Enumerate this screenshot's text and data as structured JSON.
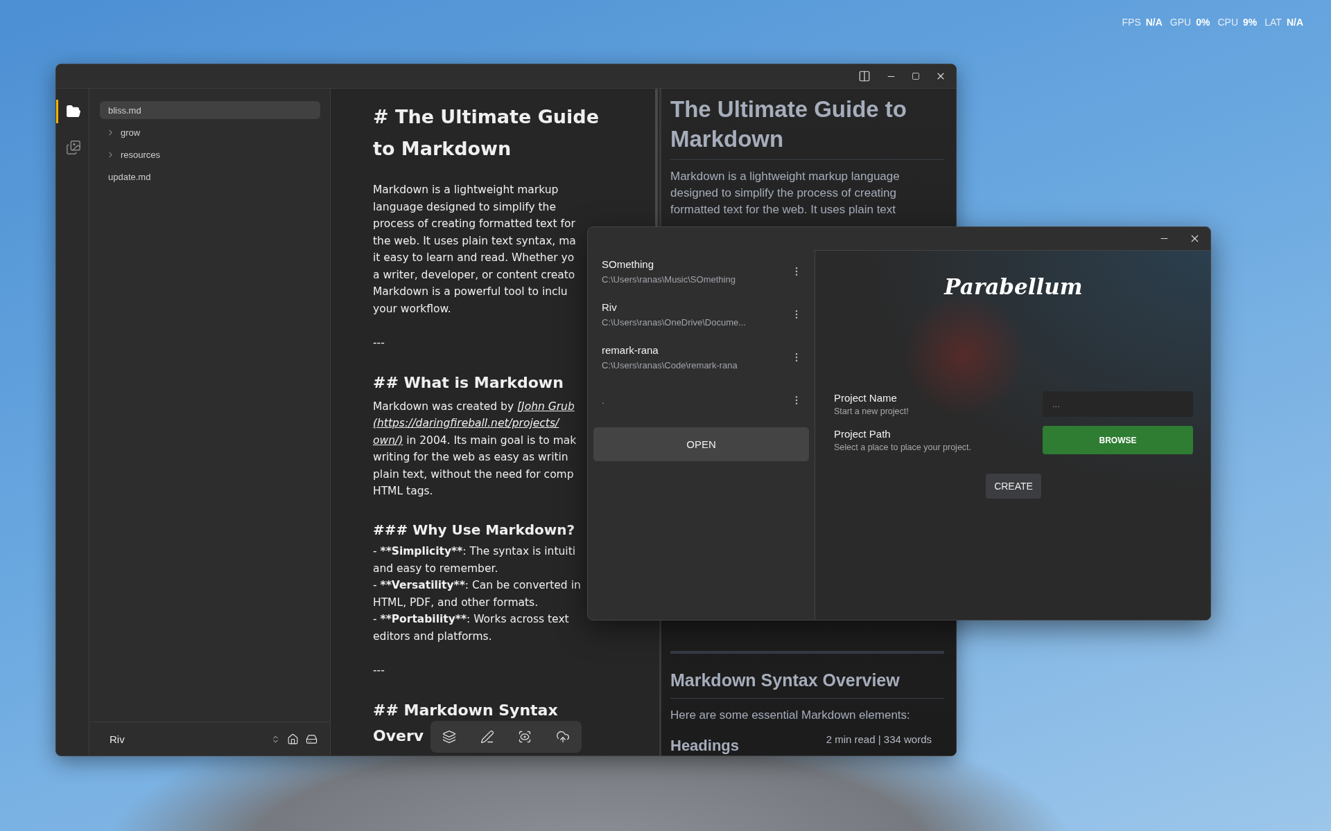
{
  "hud": [
    {
      "label": "FPS",
      "value": "N/A"
    },
    {
      "label": "GPU",
      "value": "0%"
    },
    {
      "label": "CPU",
      "value": "9%"
    },
    {
      "label": "LAT",
      "value": "N/A"
    }
  ],
  "main_window": {
    "activity_bar": [
      {
        "kind": "files",
        "selected": true
      },
      {
        "kind": "gallery",
        "selected": false
      }
    ],
    "sidebar": {
      "items": [
        {
          "label": "bliss.md",
          "kind": "file",
          "selected": true
        },
        {
          "label": "grow",
          "kind": "folder",
          "selected": false,
          "expanded": false
        },
        {
          "label": "resources",
          "kind": "folder",
          "selected": false,
          "expanded": false
        },
        {
          "label": "update.md",
          "kind": "file",
          "selected": false
        }
      ],
      "workspace": "Riv"
    },
    "editor": {
      "lines": [
        {
          "kind": "h1",
          "text": "# The Ultimate Guide"
        },
        {
          "kind": "h1",
          "text": "to Markdown"
        },
        {
          "kind": "gap"
        },
        {
          "kind": "p",
          "text": "Markdown is a lightweight markup"
        },
        {
          "kind": "p",
          "text": "language designed to simplify the"
        },
        {
          "kind": "p",
          "text": "process of creating formatted text for"
        },
        {
          "kind": "p",
          "text": "the web. It uses plain text syntax, ma"
        },
        {
          "kind": "p",
          "text": "it easy to learn and read. Whether yo"
        },
        {
          "kind": "p",
          "text": "a writer, developer, or content creato"
        },
        {
          "kind": "p",
          "text": "Markdown is a powerful tool to inclu"
        },
        {
          "kind": "p",
          "text": "your workflow."
        },
        {
          "kind": "blank"
        },
        {
          "kind": "p",
          "text": "---"
        },
        {
          "kind": "blank"
        },
        {
          "kind": "h2",
          "text": "## What is Markdown"
        },
        {
          "kind": "p",
          "parts": [
            {
              "kind": "plain",
              "text": "Markdown was created by "
            },
            {
              "kind": "link",
              "text": "[John Grub"
            }
          ]
        },
        {
          "kind": "p",
          "parts": [
            {
              "kind": "link",
              "text": "(https://daringfireball.net/projects/"
            }
          ]
        },
        {
          "kind": "p",
          "parts": [
            {
              "kind": "link",
              "text": "own/)"
            },
            {
              "kind": "plain",
              "text": " in 2004. Its main goal is to mak"
            }
          ]
        },
        {
          "kind": "p",
          "text": "writing for the web as easy as writin"
        },
        {
          "kind": "p",
          "text": "plain text, without the need for comp"
        },
        {
          "kind": "p",
          "text": "HTML tags."
        },
        {
          "kind": "blank"
        },
        {
          "kind": "h3",
          "text": "### Why Use Markdown?"
        },
        {
          "kind": "p",
          "parts": [
            {
              "kind": "plain",
              "text": "- "
            },
            {
              "kind": "bold",
              "text": "**Simplicity**"
            },
            {
              "kind": "plain",
              "text": ": The syntax is intuiti"
            }
          ]
        },
        {
          "kind": "p",
          "text": "and easy to remember."
        },
        {
          "kind": "p",
          "parts": [
            {
              "kind": "plain",
              "text": "- "
            },
            {
              "kind": "bold",
              "text": "**Versatility**"
            },
            {
              "kind": "plain",
              "text": ": Can be converted in"
            }
          ]
        },
        {
          "kind": "p",
          "text": "HTML, PDF, and other formats."
        },
        {
          "kind": "p",
          "parts": [
            {
              "kind": "plain",
              "text": "- "
            },
            {
              "kind": "bold",
              "text": "**Portability**"
            },
            {
              "kind": "plain",
              "text": ": Works across text"
            }
          ]
        },
        {
          "kind": "p",
          "text": "editors and platforms."
        },
        {
          "kind": "blank"
        },
        {
          "kind": "p",
          "text": "---"
        },
        {
          "kind": "blank"
        },
        {
          "kind": "h2",
          "text": "## Markdown Syntax"
        },
        {
          "kind": "h2",
          "text": "Overv"
        }
      ]
    },
    "preview": {
      "top": [
        {
          "kind": "h1",
          "text": "The Ultimate Guide to"
        },
        {
          "kind": "h1",
          "text": "Markdown"
        },
        {
          "kind": "rule"
        },
        {
          "kind": "p",
          "text": "Markdown is a lightweight markup language"
        },
        {
          "kind": "p",
          "text": "designed to simplify the process of creating"
        },
        {
          "kind": "p",
          "text": "formatted text for the web. It uses plain text"
        }
      ],
      "bottom": [
        {
          "kind": "thick-rule"
        },
        {
          "kind": "h2",
          "text": "Markdown Syntax Overview"
        },
        {
          "kind": "rule"
        },
        {
          "kind": "p",
          "text": "Here are some essential Markdown elements:"
        },
        {
          "kind": "h3",
          "text": "Headings"
        }
      ]
    },
    "word_count": "2 min read | 334 words"
  },
  "dialog": {
    "projects": [
      {
        "name": "SOmething",
        "path": "C:\\Users\\ranas\\Music\\SOmething"
      },
      {
        "name": "Riv",
        "path": "C:\\Users\\ranas\\OneDrive\\Docume..."
      },
      {
        "name": "remark-rana",
        "path": "C:\\Users\\ranas\\Code\\remark-rana"
      },
      {
        "path": "."
      }
    ],
    "open_button": "OPEN",
    "logo": "Parabellum",
    "fields": [
      {
        "kind": "input",
        "label": "Project Name",
        "hint": "Start a new project!",
        "placeholder": "..."
      },
      {
        "kind": "button",
        "label": "Project Path",
        "hint": "Select a place to place your project.",
        "button": "BROWSE"
      }
    ],
    "create_button": "CREATE"
  }
}
